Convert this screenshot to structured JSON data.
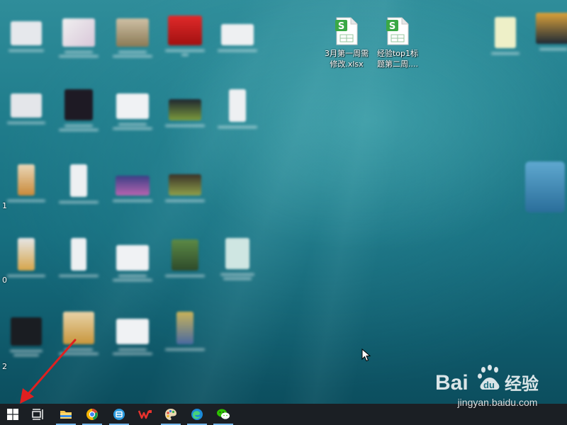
{
  "desktop": {
    "files": [
      {
        "name": "3月第一周需修改.xlsx",
        "lines": [
          "3月第一周需",
          "修改.xlsx"
        ]
      },
      {
        "name": "经验top1标题第二周....",
        "lines": [
          "经验top1标",
          "题第二周...."
        ]
      }
    ],
    "edge_numbers": [
      "1",
      "0",
      "2"
    ]
  },
  "taskbar": {
    "items": [
      {
        "name": "start-button",
        "icon": "windows-logo-icon"
      },
      {
        "name": "task-view-button",
        "icon": "task-view-icon"
      },
      {
        "name": "file-explorer-button",
        "icon": "folder-icon"
      },
      {
        "name": "browser-button",
        "icon": "browser-icon"
      },
      {
        "name": "mail-button",
        "icon": "mail-icon"
      },
      {
        "name": "wps-button",
        "icon": "wps-icon"
      },
      {
        "name": "paint-button",
        "icon": "palette-icon"
      },
      {
        "name": "edge-button",
        "icon": "edge-icon"
      },
      {
        "name": "wechat-button",
        "icon": "wechat-icon"
      }
    ]
  },
  "watermark": {
    "brand": "Bai",
    "brand2": "经验",
    "url": "jingyan.baidu.com"
  },
  "colors": {
    "arrow": "#e02020",
    "taskbar": "#1b1f24",
    "sheet_green": "#3aa845"
  }
}
